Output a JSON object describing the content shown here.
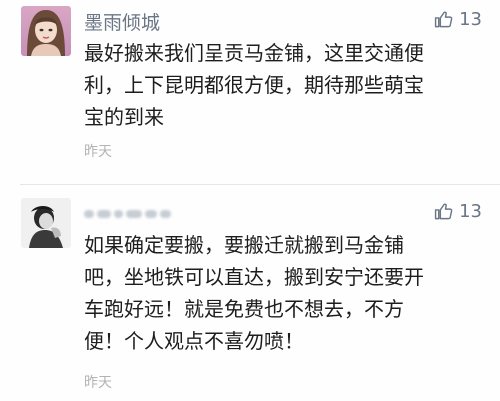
{
  "comments": [
    {
      "username": "墨雨倾城",
      "likes": "13",
      "content": "最好搬来我们呈贡马金铺，这里交通便\n利，上下昆明都很方便，期待那些萌宝\n宝的到来",
      "time": "昨天",
      "like_icon": "thumbs-up-icon"
    },
    {
      "username": "",
      "username_obscured": true,
      "likes": "13",
      "content": "如果确定要搬，要搬迁就搬到马金铺\n吧，坐地铁可以直达，搬到安宁还要开\n车跑好远！就是免费也不想去，不方\n便！个人观点不喜勿喷！",
      "time": "昨天",
      "like_icon": "thumbs-up-icon"
    }
  ],
  "colors": {
    "username": "#6a7585",
    "content": "#1d1d1d",
    "timestamp": "#b3b3b3"
  }
}
